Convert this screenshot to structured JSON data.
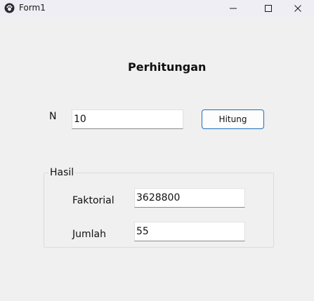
{
  "window": {
    "title": "Form1",
    "app_icon": "paw-icon",
    "controls": [
      "minimize-icon",
      "maximize-icon",
      "close-icon"
    ]
  },
  "form": {
    "heading": "Perhitungan",
    "n_label": "N",
    "n_value": "10",
    "calculate_button": "Hitung"
  },
  "result": {
    "group_label": "Hasil",
    "factorial_label": "Faktorial",
    "factorial_value": "3628800",
    "sum_label": "Jumlah",
    "sum_value": "55"
  },
  "colors": {
    "background": "#f0f0f0",
    "titlebar": "#eeeef4",
    "button_border": "#1f6fb8",
    "textbox": "#ffffff"
  }
}
